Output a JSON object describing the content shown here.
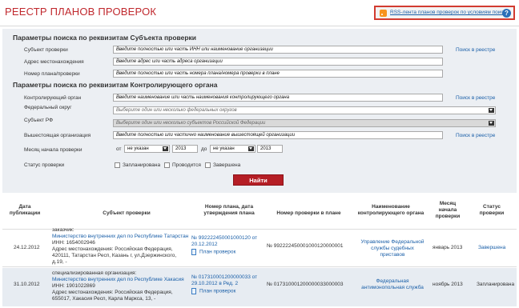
{
  "header": {
    "title": "РЕЕСТР ПЛАНОВ ПРОВЕРОК",
    "rss_link": "RSS-лента планов проверок по условиям поиска",
    "help_symbol": "?"
  },
  "search": {
    "subject_section": {
      "title": "Параметры поиска по реквизитам Субъекта проверки",
      "subject_label": "Субъект проверки",
      "subject_value": "Введите полностью или часть ИНН или наименование организации",
      "address_label": "Адрес местонахождения",
      "address_value": "Введите адрес или часть адреса организации",
      "number_label": "Номер плана/проверки",
      "number_value": "Введите полностью или часть номера плана/номера проверки в плане",
      "registry_link": "Поиск в реестре"
    },
    "organ_section": {
      "title": "Параметры поиска по реквизитам Контролирующего органа",
      "organ_label": "Контролирующий орган",
      "organ_value": "Введите наименование или часть наименования контролирующего органа",
      "registry_link": "Поиск в реестре",
      "district_label": "Федеральный округ",
      "district_value": "Выберите один или несколько федеральных округов",
      "region_label": "Субъект РФ",
      "region_value": "Выберите один или несколько субъектов Российской Федерации",
      "higher_label": "Вышестоящая организация",
      "higher_value": "Введите полностью или частично наименование вышестоящей организации",
      "higher_link": "Поиск в реестре",
      "month_label": "Месяц начала проверки",
      "from_label": "от",
      "from_month": "не указан",
      "from_year": "2013",
      "to_label": "до",
      "to_month": "не указан",
      "to_year": "2013",
      "status_label": "Статус проверки",
      "status_options": [
        "Запланирована",
        "Проводится",
        "Завершена"
      ]
    },
    "find_button": "Найти"
  },
  "table": {
    "headers": {
      "date": "Дата публикации",
      "subject": "Субъект проверки",
      "plan": "Номер плана, дата утверждения плана",
      "check_no": "Номер проверки в плане",
      "organ": "Наименование контролирующего органа",
      "month": "Месяц начала проверки",
      "status": "Статус проверки"
    },
    "rows": [
      {
        "date": "24.12.2012",
        "role": "заказчик:",
        "org": "Министерство внутренних дел по Республике Татарстан",
        "inn": "ИНН: 1654002946",
        "addr1": "Адрес местонахождения: Российская Федерация,",
        "addr2": "420111, Татарстан Респ, Казань г, ул.Дзержинского,",
        "addr3": "д.19, -",
        "plan1": "№ 992222450001000120 от",
        "plan2": "20.12.2012",
        "plan_link": "План проверок",
        "check_no": "№ 992222450001000120000001",
        "organ1": "Управление Федеральной",
        "organ2": "службы судебных приставов",
        "month": "январь 2013",
        "status": "Завершена"
      },
      {
        "date": "31.10.2012",
        "role": "специализированная организация:",
        "org": "Министерство внутренних дел по Республике Хакасия",
        "inn": "ИНН: 1901022869",
        "addr1": "Адрес местонахождения: Российская Федерация,",
        "addr2": "655017, Хакасия Респ, Карла Маркса, 13, -",
        "addr3": "",
        "plan1": "№ 017310001200000033 от",
        "plan2": "29.10.2012 в Ред. 2",
        "plan_link": "План проверок",
        "check_no": "№ 017310001200000033000003",
        "organ1": "Федеральная",
        "organ2": "антимонопольная служба",
        "month": "ноябрь 2013",
        "status": "Запланирована"
      }
    ]
  }
}
